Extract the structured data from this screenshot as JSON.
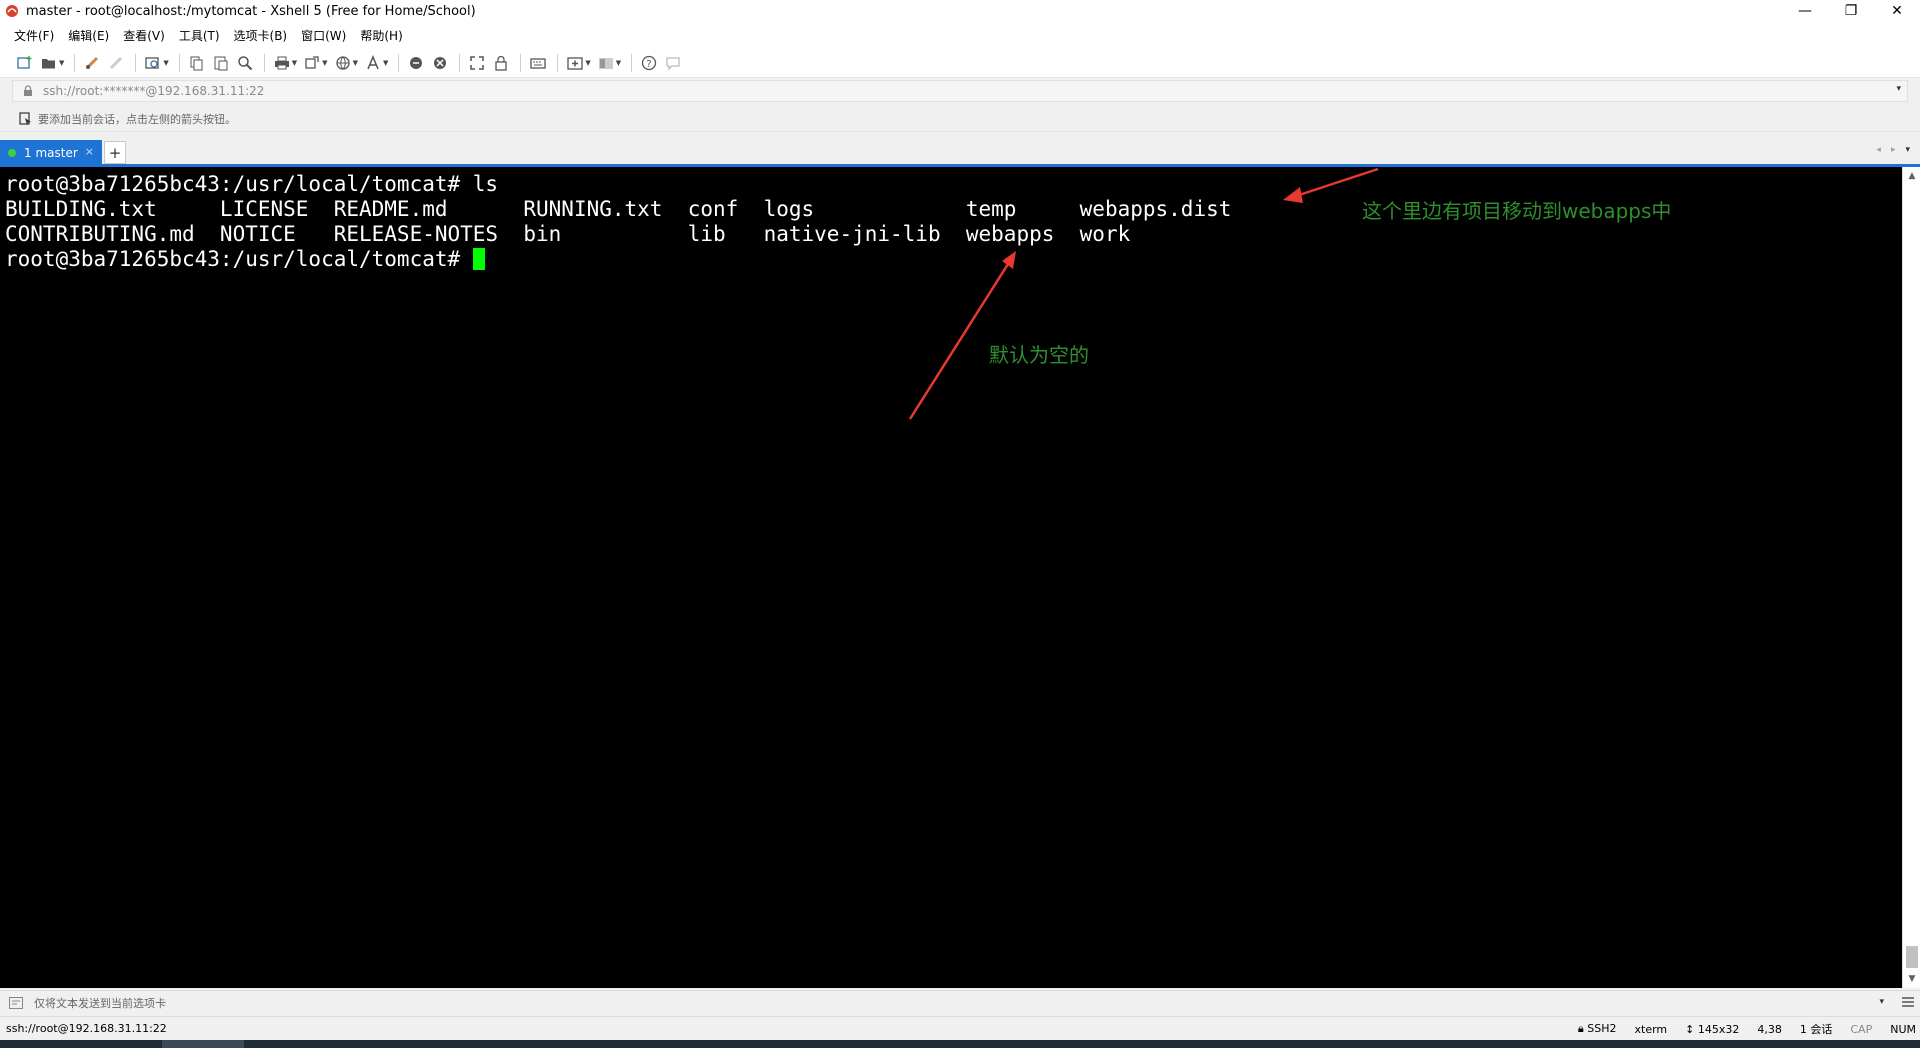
{
  "window": {
    "title": "master - root@localhost:/mytomcat - Xshell 5 (Free for Home/School)",
    "controls": {
      "minimize": "—",
      "maximize": "❐",
      "close": "✕"
    }
  },
  "menu": {
    "items": [
      "文件(F)",
      "编辑(E)",
      "查看(V)",
      "工具(T)",
      "选项卡(B)",
      "窗口(W)",
      "帮助(H)"
    ]
  },
  "address": {
    "value": "ssh://root:*******@192.168.31.11:22",
    "dropdown": "▾"
  },
  "hint": {
    "text": "要添加当前会话，点击左侧的箭头按钮。"
  },
  "tabs": {
    "active_label": "1 master",
    "close": "×",
    "add": "+",
    "nav_left": "◂",
    "nav_right": "▸",
    "nav_menu": "▾"
  },
  "terminal": {
    "lines": [
      "root@3ba71265bc43:/usr/local/tomcat# ls",
      "BUILDING.txt     LICENSE  README.md      RUNNING.txt  conf  logs            temp     webapps.dist",
      "CONTRIBUTING.md  NOTICE   RELEASE-NOTES  bin          lib   native-jni-lib  webapps  work",
      "root@3ba71265bc43:/usr/local/tomcat# "
    ],
    "cursor_color": "#00ff00",
    "background": "#000000",
    "foreground": "#ffffff"
  },
  "annotations": {
    "move_note": "这个里边有项目移动到webapps中",
    "empty_note": "默认为空的",
    "text_color": "#2f8f2f",
    "arrow_color": "#e8392f"
  },
  "compose": {
    "placeholder": "仅将文本发送到当前选项卡",
    "dropdown": "▾"
  },
  "status": {
    "left": "ssh://root@192.168.31.11:22",
    "protocol": "SSH2",
    "terminal_type": "xterm",
    "size": "145x32",
    "cursor_pos": "4,38",
    "sessions": "1 会话",
    "caps": "CAP",
    "num": "NUM"
  },
  "colors": {
    "accent": "#1e73d4",
    "tab_dot": "#3dd03d"
  }
}
